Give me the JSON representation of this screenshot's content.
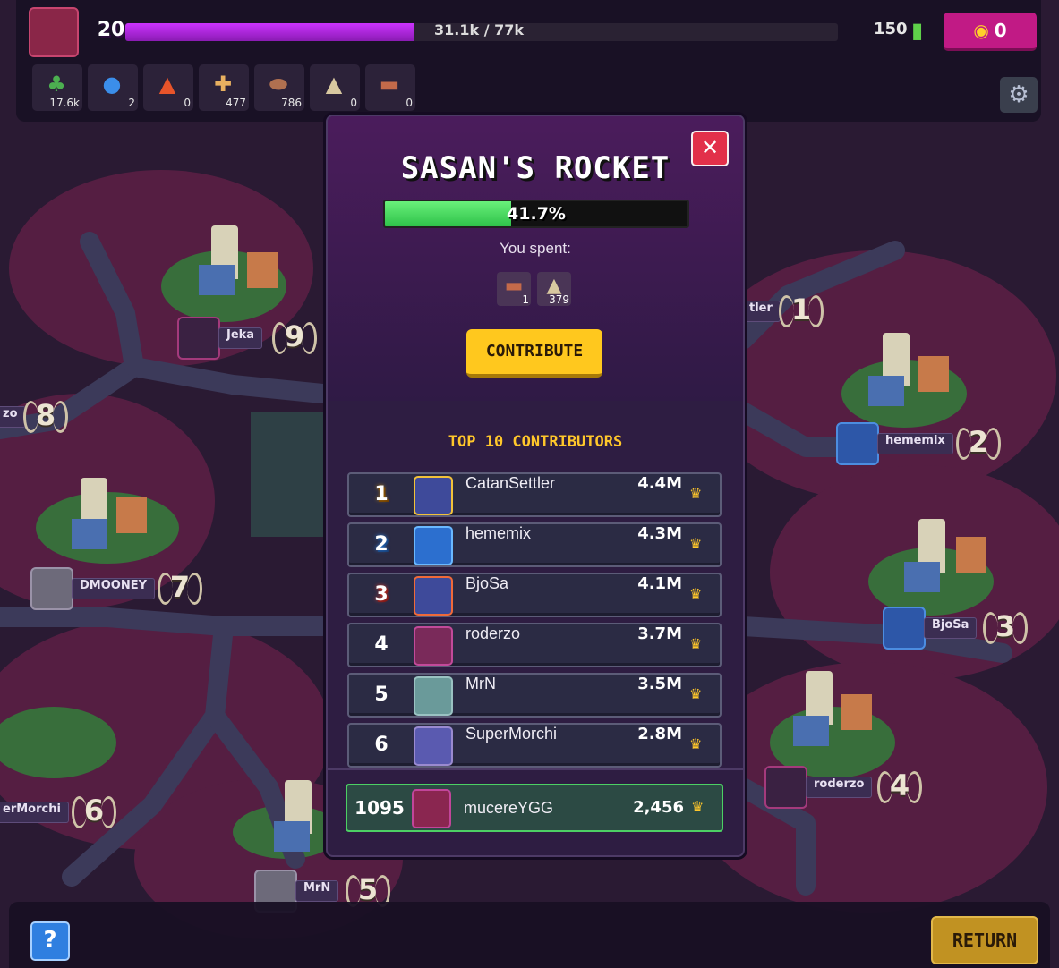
{
  "hud": {
    "level": "20",
    "xp_text": "31.1k / 77k",
    "xp_progress": 0.404,
    "energy": "150",
    "coins": "0",
    "resources": [
      {
        "icon": "plant-resource-icon",
        "count": "17.6k"
      },
      {
        "icon": "water-drop-icon",
        "count": "2"
      },
      {
        "icon": "fire-icon",
        "count": "0"
      },
      {
        "icon": "bones-icon",
        "count": "477"
      },
      {
        "icon": "rock-icon",
        "count": "786"
      },
      {
        "icon": "sand-pile-icon",
        "count": "0"
      },
      {
        "icon": "plank-icon",
        "count": "0"
      }
    ]
  },
  "map": {
    "players": [
      {
        "name": "Jeka",
        "rank": "9"
      },
      {
        "name": "tler",
        "rank": "1"
      },
      {
        "name": "zo",
        "rank": "8"
      },
      {
        "name": "hememix",
        "rank": "2"
      },
      {
        "name": "DMOONEY",
        "rank": "7"
      },
      {
        "name": "BjoSa",
        "rank": "3"
      },
      {
        "name": "roderzo",
        "rank": "4"
      },
      {
        "name": "erMorchi",
        "rank": "6"
      },
      {
        "name": "MrN",
        "rank": "5"
      }
    ]
  },
  "modal": {
    "title": "SASAN'S ROCKET",
    "progress_text": "41.7%",
    "progress": 0.417,
    "spent_label": "You spent:",
    "spent": [
      {
        "icon": "plank-icon",
        "count": "1"
      },
      {
        "icon": "sand-pile-icon",
        "count": "379"
      }
    ],
    "contribute_label": "CONTRIBUTE",
    "contributors_heading": "TOP 10 CONTRIBUTORS",
    "contributors": [
      {
        "rank": "1",
        "name": "CatanSettler",
        "score": "4.4M"
      },
      {
        "rank": "2",
        "name": "hememix",
        "score": "4.3M"
      },
      {
        "rank": "3",
        "name": "BjoSa",
        "score": "4.1M"
      },
      {
        "rank": "4",
        "name": "roderzo",
        "score": "3.7M"
      },
      {
        "rank": "5",
        "name": "MrN",
        "score": "3.5M"
      },
      {
        "rank": "6",
        "name": "SuperMorchi",
        "score": "2.8M"
      }
    ],
    "own": {
      "rank": "1095",
      "name": "mucereYGG",
      "score": "2,456"
    }
  },
  "bottom": {
    "help_label": "?",
    "return_label": "RETURN"
  },
  "colors": {
    "accent_magenta": "#c11a85",
    "progress_green": "#2fc24a",
    "button_yellow": "#ffc81e",
    "heading_gold": "#ffc72b",
    "own_row_border": "#4cd064"
  }
}
